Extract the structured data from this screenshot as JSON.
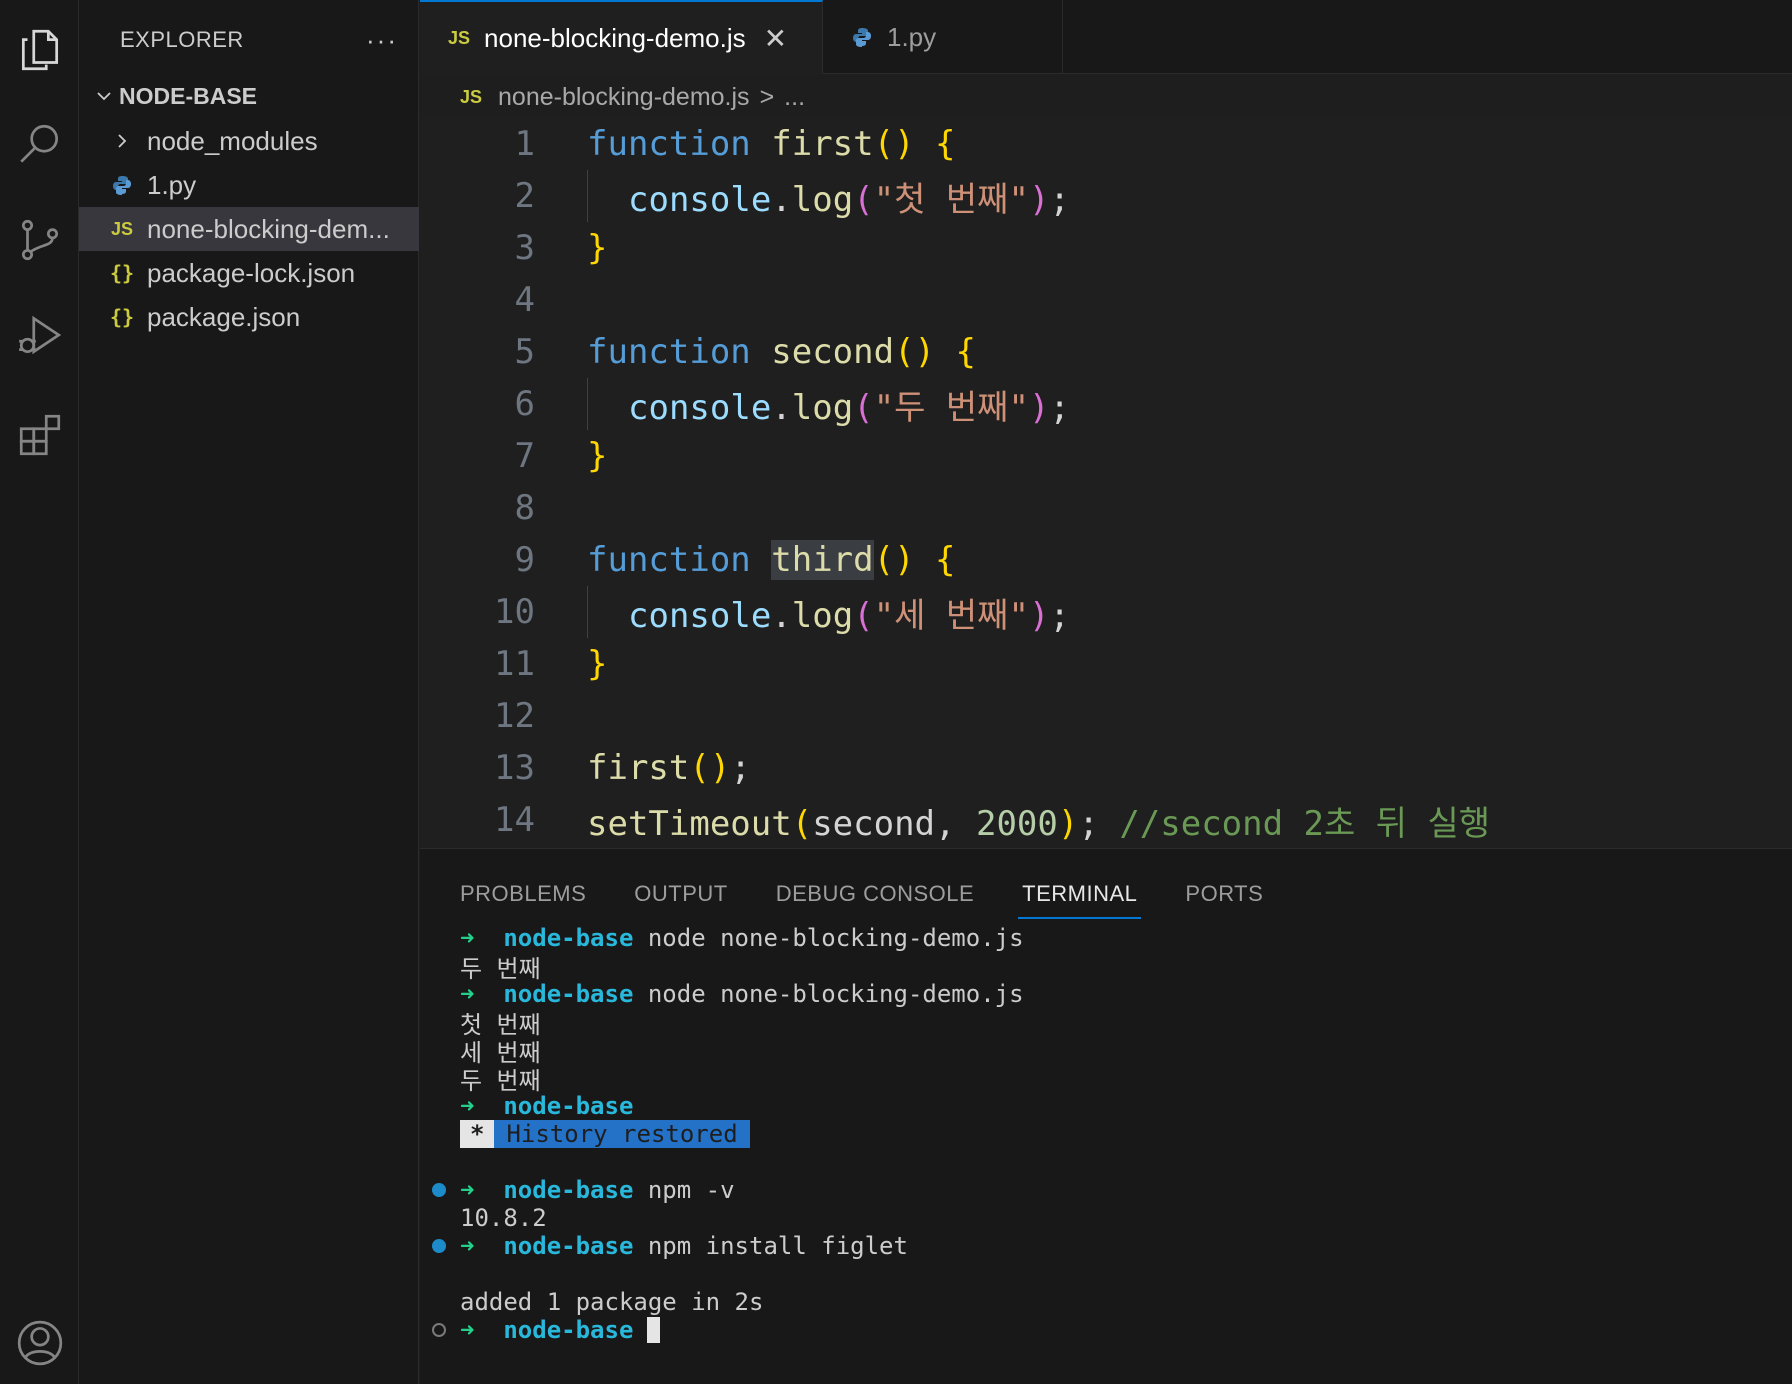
{
  "activity_bar": {
    "icons": [
      "explorer-icon",
      "search-icon",
      "source-control-icon",
      "run-debug-icon",
      "extensions-icon",
      "account-icon"
    ]
  },
  "sidebar": {
    "title": "EXPLORER",
    "more": "···",
    "root": "NODE-BASE",
    "items": [
      {
        "label": "node_modules",
        "icon": "chevron-right-icon"
      },
      {
        "label": "1.py",
        "icon": "python-icon"
      },
      {
        "label": "none-blocking-dem...",
        "icon": "js-icon",
        "icon_text": "JS",
        "selected": true
      },
      {
        "label": "package-lock.json",
        "icon": "json-icon",
        "icon_text": "{}"
      },
      {
        "label": "package.json",
        "icon": "json-icon",
        "icon_text": "{}"
      }
    ]
  },
  "tabs": [
    {
      "label": "none-blocking-demo.js",
      "icon_text": "JS",
      "active": true,
      "close": "✕"
    },
    {
      "label": "1.py",
      "icon": "python-icon",
      "active": false
    }
  ],
  "breadcrumb": {
    "icon_text": "JS",
    "file": "none-blocking-demo.js",
    "sep": ">",
    "rest": "..."
  },
  "editor": {
    "line_numbers": [
      "1",
      "2",
      "3",
      "4",
      "5",
      "6",
      "7",
      "8",
      "9",
      "10",
      "11",
      "12",
      "13",
      "14"
    ],
    "t": {
      "function": "function",
      "first": "first",
      "second": "second",
      "third": "third",
      "console": "console",
      "dot": ".",
      "log": "log",
      "paren_open": "(",
      "paren_close": ")",
      "parens": "()",
      "brace_open": "{",
      "brace_close": "}",
      "semi": ";",
      "str1": "\"첫 번째\"",
      "str2": "\"두 번째\"",
      "str3": "\"세 번째\"",
      "setTimeout": "setTimeout",
      "comma": ", ",
      "num": "2000",
      "comment": "//second 2초 뒤 실행"
    }
  },
  "panel": {
    "tabs": [
      "PROBLEMS",
      "OUTPUT",
      "DEBUG CONSOLE",
      "TERMINAL",
      "PORTS"
    ],
    "active_tab": "TERMINAL",
    "terminal": {
      "arrow": "➜",
      "dir": "node-base",
      "cmd1": "node none-blocking-demo.js",
      "out1": "두 번째",
      "cmd2": "node none-blocking-demo.js",
      "out2a": "첫 번째",
      "out2b": "세 번째",
      "out2c": "두 번째",
      "hist_star": "*",
      "hist_text": "History restored",
      "cmd3": "npm -v",
      "out3": "10.8.2",
      "cmd4": "npm install figlet",
      "out4": "added 1 package in 2s"
    }
  },
  "colors": {
    "accent": "#0078d4",
    "keyword": "#569cd6",
    "function": "#dcdcaa",
    "string": "#ce9178",
    "comment": "#6a9955",
    "terminal_dir": "#29b8db",
    "terminal_arrow": "#23d18b"
  }
}
